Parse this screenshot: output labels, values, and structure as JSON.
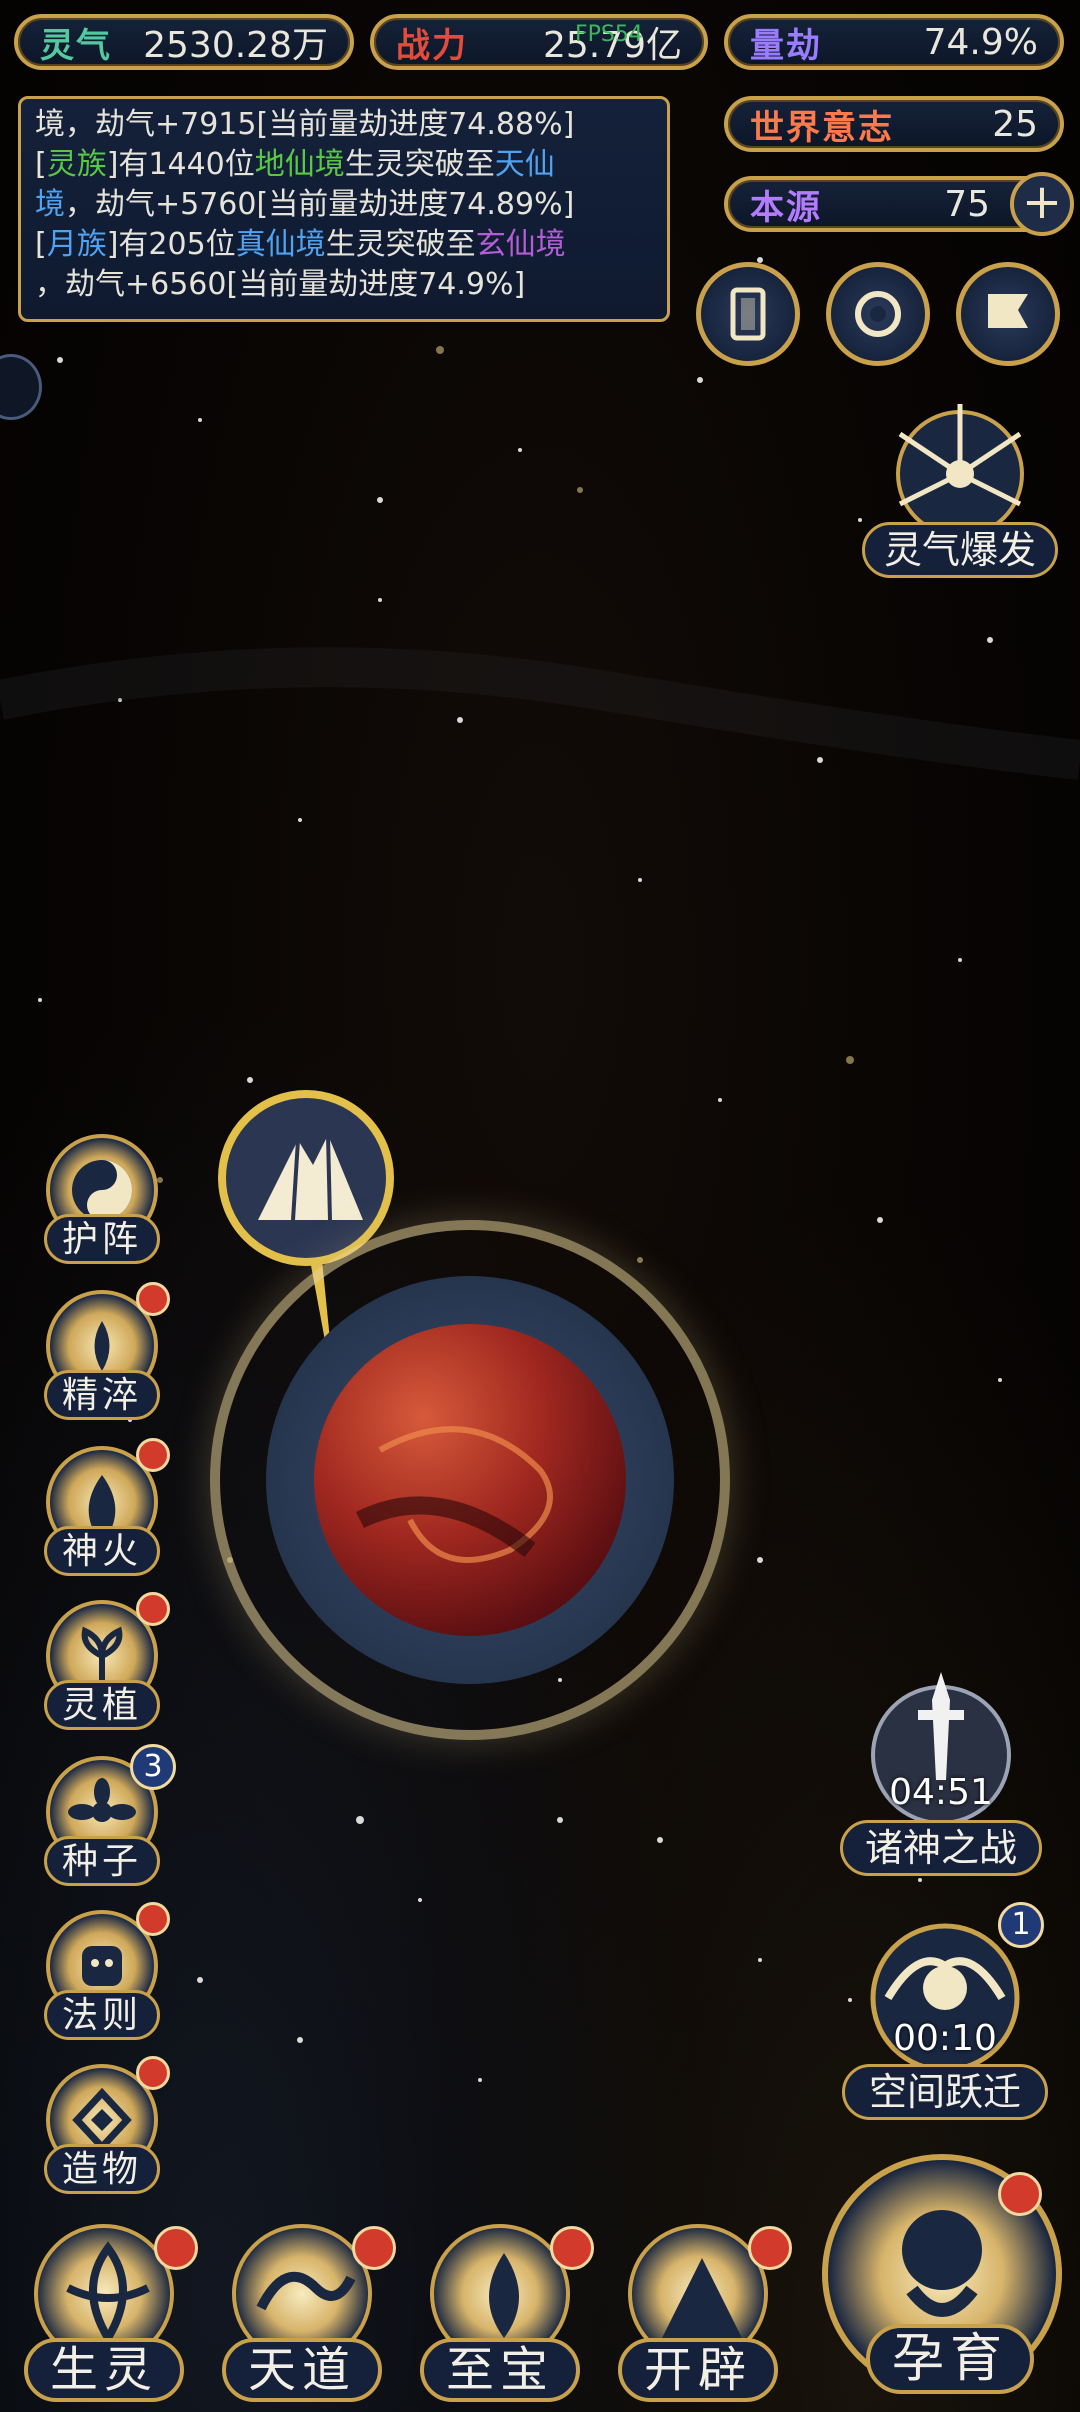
{
  "resources": {
    "lingqi": {
      "label": "灵气",
      "value": "2530.28万"
    },
    "zhanli": {
      "label": "战力",
      "value": "25.79亿"
    },
    "liangjie": {
      "label": "量劫",
      "value": "74.9%"
    },
    "shijie": {
      "label": "世界意志",
      "value": "25"
    },
    "benyuan": {
      "label": "本源",
      "value": "75"
    }
  },
  "fps": "FPS54",
  "log": {
    "line1_a": "境，劫气+7915[当前量劫进度74.88%]",
    "line2_a": "[",
    "line2_race": "灵族",
    "line2_b": "]有1440位",
    "line2_realm1": "地仙境",
    "line2_c": "生灵突破至",
    "line2_realm2": "天仙",
    "line3_realm": "境",
    "line3_a": "，劫气+5760[当前量劫进度74.89%]",
    "line4_a": "[",
    "line4_race": "月族",
    "line4_b": "]有205位",
    "line4_realm1": "真仙境",
    "line4_c": "生灵突破至",
    "line4_realm2": "玄仙境",
    "line5_a": "，劫气+6560[当前量劫进度74.9%]"
  },
  "right_actions": {
    "burst_label": "灵气爆发",
    "battle_label": "诸神之战",
    "battle_timer": "04:51",
    "jump_label": "空间跃迁",
    "jump_timer": "00:10",
    "jump_badge": "1"
  },
  "side_menu": [
    {
      "label": "护阵",
      "badge": false
    },
    {
      "label": "精淬",
      "badge": true
    },
    {
      "label": "神火",
      "badge": true
    },
    {
      "label": "灵植",
      "badge": true
    },
    {
      "label": "种子",
      "badge": "3"
    },
    {
      "label": "法则",
      "badge": true
    },
    {
      "label": "造物",
      "badge": true
    }
  ],
  "bottom_nav": [
    {
      "label": "生灵"
    },
    {
      "label": "天道"
    },
    {
      "label": "至宝"
    },
    {
      "label": "开辟"
    },
    {
      "label": "孕育"
    }
  ],
  "side_badge_seed": "3",
  "colors": {
    "gold": "#c9a14a",
    "panel": "#15213a",
    "badge_red": "#d23a2c",
    "green": "#59c945",
    "blue": "#4fa3f0",
    "purple": "#b35ed6"
  }
}
